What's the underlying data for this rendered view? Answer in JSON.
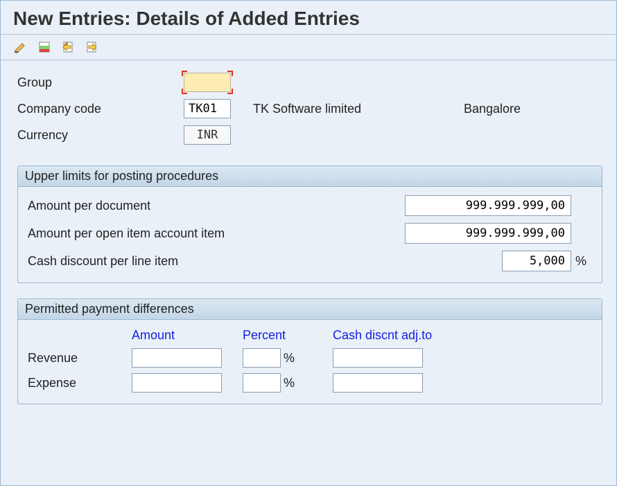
{
  "title": "New Entries: Details of Added Entries",
  "form": {
    "group": {
      "label": "Group",
      "value": ""
    },
    "company_code": {
      "label": "Company code",
      "value": "TK01",
      "desc": "TK Software limited",
      "city": "Bangalore"
    },
    "currency": {
      "label": "Currency",
      "value": "INR"
    }
  },
  "limits": {
    "title": "Upper limits for posting procedures",
    "rows": {
      "amount_doc": {
        "label": "Amount per document",
        "value": "999.999.999,00"
      },
      "amount_open_item": {
        "label": "Amount per open item account item",
        "value": "999.999.999,00"
      },
      "cash_discount": {
        "label": "Cash discount per line item",
        "value": "5,000",
        "suffix": "%"
      }
    }
  },
  "diffs": {
    "title": "Permitted payment differences",
    "cols": {
      "amount": "Amount",
      "percent": "Percent",
      "cash": "Cash discnt adj.to"
    },
    "rows": {
      "revenue": {
        "label": "Revenue",
        "amount": "",
        "percent": "",
        "cash": ""
      },
      "expense": {
        "label": "Expense",
        "amount": "",
        "percent": "",
        "cash": ""
      }
    },
    "pct_sign": "%"
  }
}
